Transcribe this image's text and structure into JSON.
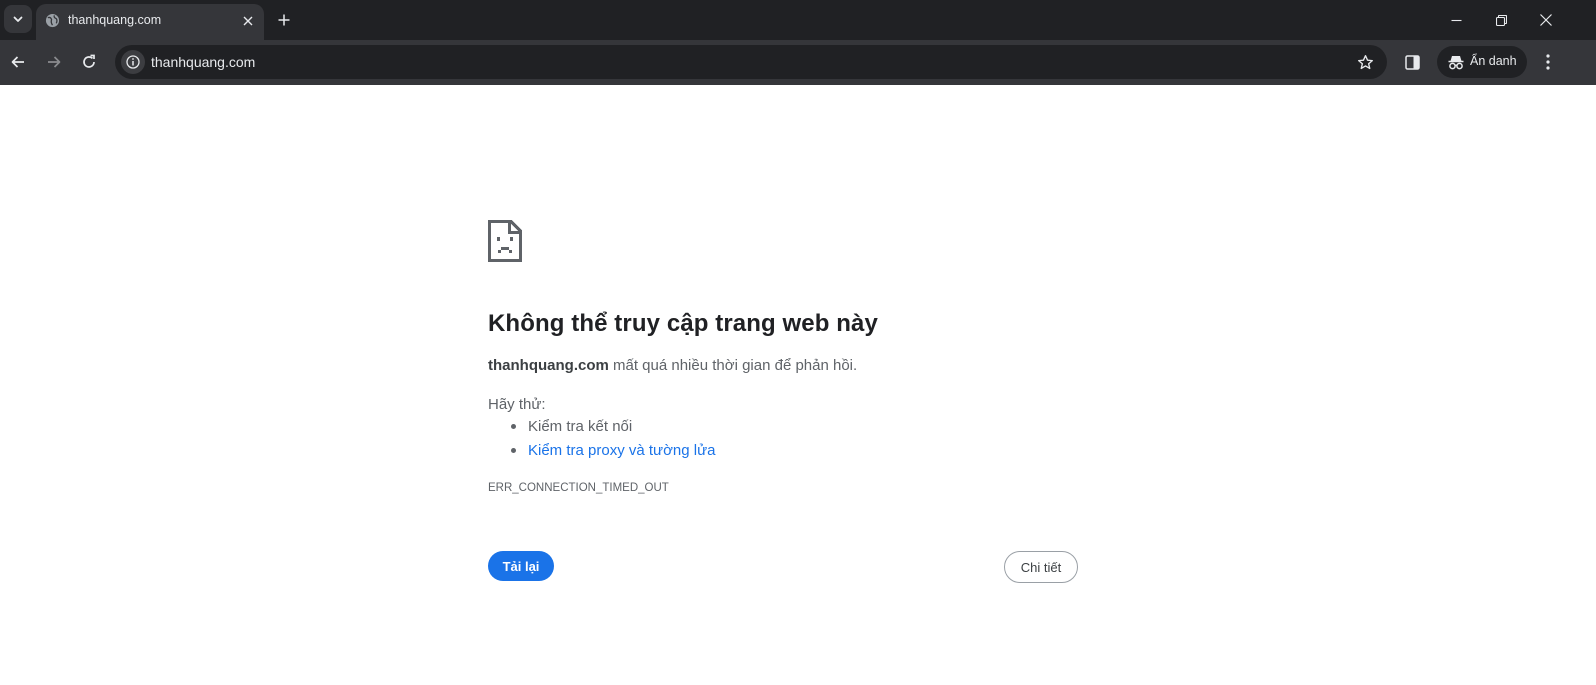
{
  "browser": {
    "tab": {
      "title": "thanhquang.com",
      "favicon": "globe-icon"
    },
    "omnibox": {
      "url": "thanhquang.com"
    },
    "incognito_label": "Ẩn danh",
    "colors": {
      "frame": "#202124",
      "toolbar": "#35363a",
      "text": "#e8eaed"
    }
  },
  "error_page": {
    "icon": "sad-page-icon",
    "title": "Không thể truy cập trang web này",
    "description": {
      "host": "thanhquang.com",
      "message": " mất quá nhiều thời gian để phản hồi."
    },
    "try_label": "Hãy thử:",
    "suggestions": [
      {
        "text": "Kiểm tra kết nối",
        "link": false
      },
      {
        "text": "Kiểm tra proxy và tường lửa",
        "link": true
      }
    ],
    "error_code": "ERR_CONNECTION_TIMED_OUT",
    "reload_label": "Tải lại",
    "details_label": "Chi tiết",
    "colors": {
      "primary": "#1a73e8",
      "text": "#5f6368",
      "heading": "#202124"
    }
  }
}
